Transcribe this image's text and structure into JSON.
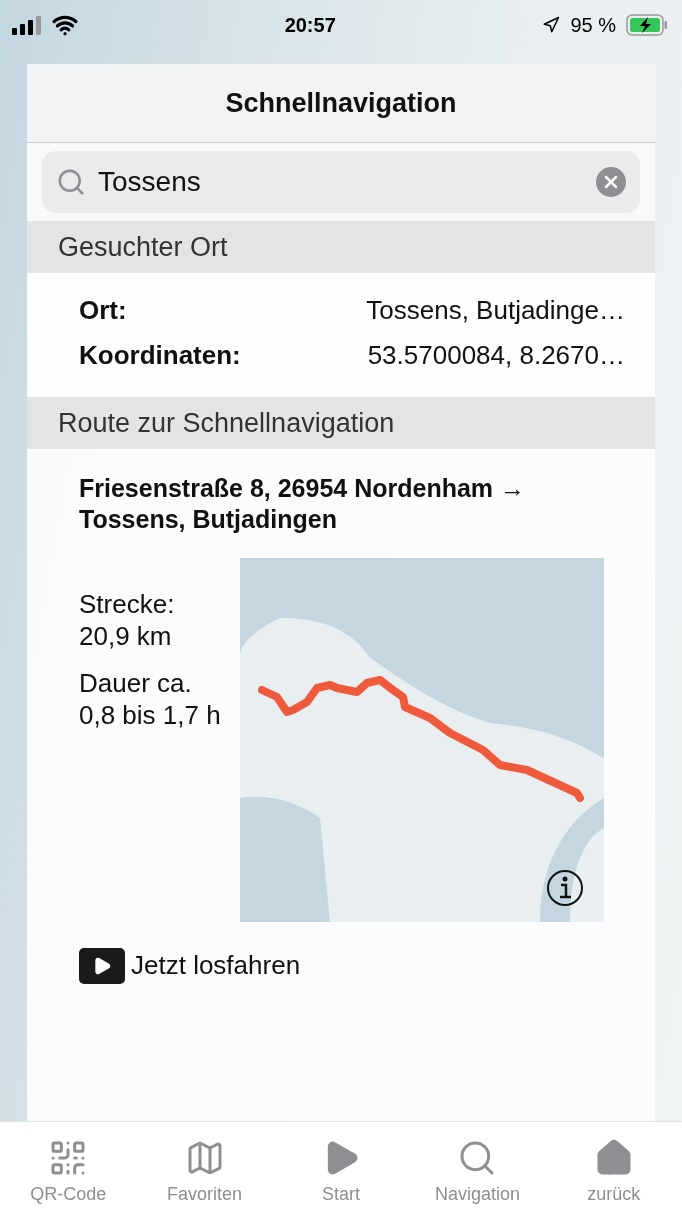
{
  "status_bar": {
    "time": "20:57",
    "battery": "95 %"
  },
  "dialog": {
    "title": "Schnellnavigation",
    "search": {
      "value": "Tossens"
    },
    "place_section": {
      "header": "Gesuchter Ort",
      "fields": [
        {
          "label": "Ort:",
          "value": "Tossens, Butjadinge…"
        },
        {
          "label": "Koordinaten:",
          "value": "53.5700084, 8.2670…"
        }
      ]
    },
    "route_section": {
      "header": "Route zur Schnellnavigation",
      "route": "Friesenstraße 8, 26954 Nordenham → Tossens, Butjadingen",
      "stats": [
        {
          "label": "Strecke:",
          "value": "20,9 km"
        },
        {
          "label": "Dauer ca.",
          "value": "0,8 bis 1,7 h"
        }
      ],
      "start_button": "Jetzt losfahren"
    }
  },
  "tab_bar": [
    {
      "kind": "qr",
      "label": "QR-Code"
    },
    {
      "kind": "map",
      "label": "Favoriten"
    },
    {
      "kind": "play",
      "label": "Start"
    },
    {
      "kind": "search",
      "label": "Navigation"
    },
    {
      "kind": "home",
      "label": "zurück"
    }
  ]
}
